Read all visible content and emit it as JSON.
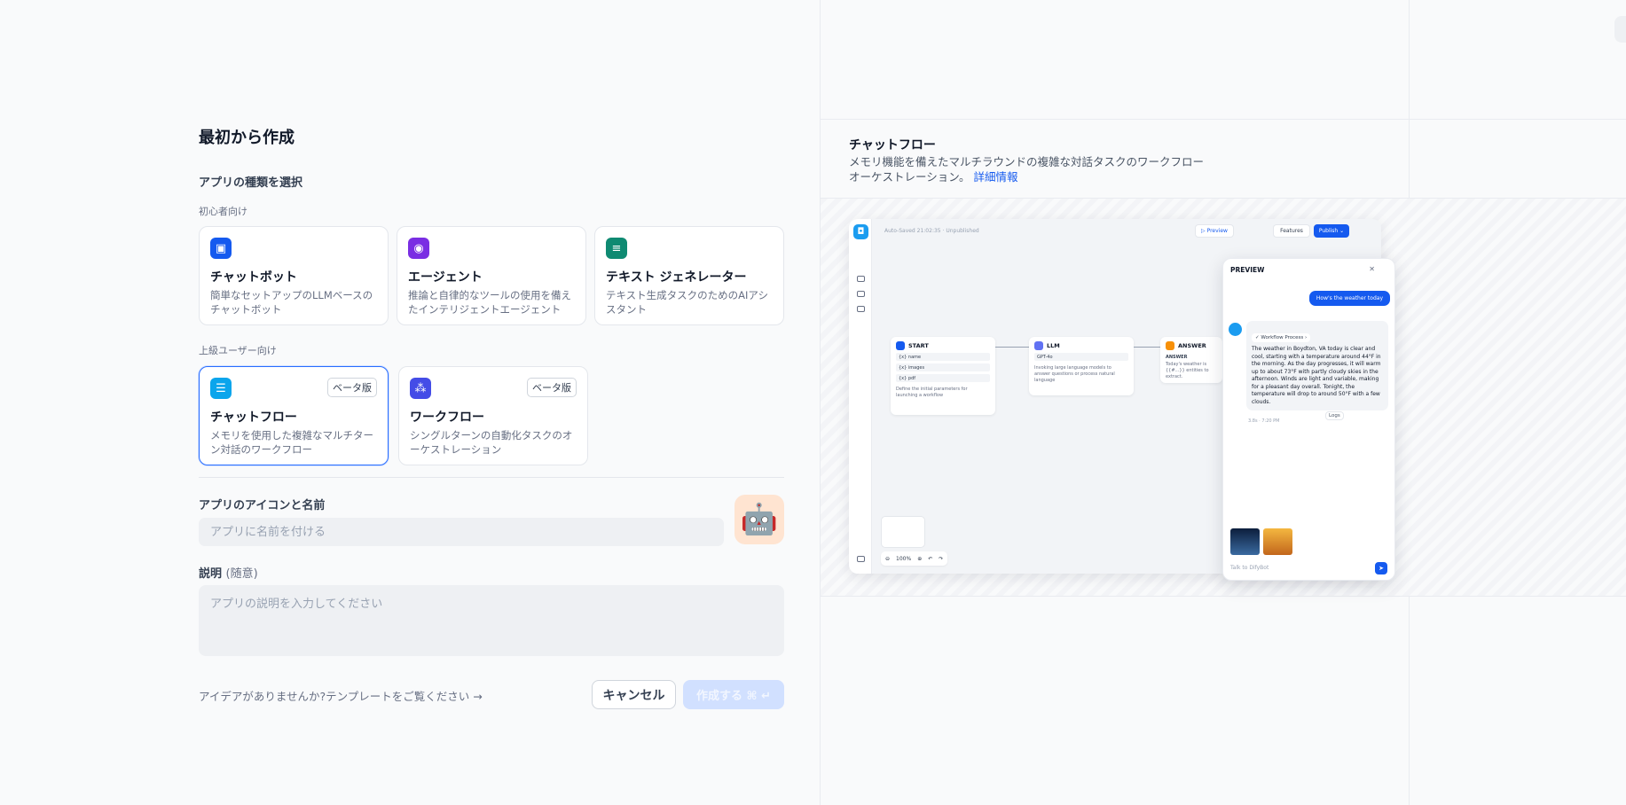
{
  "left": {
    "page_title": "最初から作成",
    "type_section_label": "アプリの種類を選択",
    "beginner_label": "初心者向け",
    "advanced_label": "上級ユーザー向け",
    "beginner_cards": [
      {
        "title": "チャットボット",
        "desc": "簡単なセットアップのLLMベースのチャットボット",
        "icon": "chatbot-icon",
        "color": "#155aef"
      },
      {
        "title": "エージェント",
        "desc": "推論と自律的なツールの使用を備えたインテリジェントエージェント",
        "icon": "agent-icon",
        "color": "#7a2ee3"
      },
      {
        "title": "テキスト ジェネレーター",
        "desc": "テキスト生成タスクのためのAIアシスタント",
        "icon": "text-generator-icon",
        "color": "#0f8a72"
      }
    ],
    "advanced_cards": [
      {
        "title": "チャットフロー",
        "desc": "メモリを使用した複雑なマルチターン対話のワークフロー",
        "icon": "chatflow-icon",
        "color": "#0ba5ec",
        "badge": "ベータ版",
        "selected": true
      },
      {
        "title": "ワークフロー",
        "desc": "シングルターンの自動化タスクのオーケストレーション",
        "icon": "workflow-icon",
        "color": "#444ce7",
        "badge": "ベータ版",
        "selected": false
      }
    ],
    "name_section_label": "アプリのアイコンと名前",
    "name_placeholder": "アプリに名前を付ける",
    "avatar_emoji": "🤖",
    "desc_section_label": "説明",
    "desc_optional": "(随意)",
    "desc_placeholder": "アプリの説明を入力してください",
    "template_link": "アイデアがありませんか?テンプレートをご覧ください →",
    "cancel_label": "キャンセル",
    "create_label": "作成する ⌘ ↵"
  },
  "right": {
    "title": "チャットフロー",
    "desc": "メモリ機能を備えたマルチラウンドの複雑な対話タスクのワークフローオーケストレーション。",
    "learn_more": "詳細情報",
    "mock": {
      "autosave": "Auto-Saved 21:02:35 · Unpublished",
      "preview_btn": "▷ Preview",
      "features_btn": "Features",
      "publish_btn": "Publish ⌄",
      "nodes": {
        "start": {
          "title": "START",
          "rows": [
            "{x} name",
            "{x} images",
            "{x} pdf"
          ],
          "desc": "Define the initial parameters for launching a workflow"
        },
        "llm": {
          "title": "LLM",
          "model": "GPT-4o",
          "desc": "Invoking large language models to answer questions or process natural language"
        },
        "answer": {
          "title": "ANSWER",
          "sub": "ANSWER",
          "desc": "Today's weather is {{#...}} entities to extract."
        }
      },
      "zoom": "100%",
      "chat": {
        "title": "PREVIEW",
        "user_msg": "How's the weather today",
        "workflow_pill": "✓ Workflow Process ›",
        "bot_msg": "The weather in Boydton, VA today is clear and cool, starting with a temperature around 44°F in the morning. As the day progresses, it will warm up to about 73°F with partly cloudy skies in the afternoon. Winds are light and variable, making for a pleasant day overall. Tonight, the temperature will drop to around 50°F with a few clouds.",
        "meta": "3.8s · 7:20 PM",
        "logs": "Logs",
        "input_placeholder": "Talk to DifyBot"
      }
    }
  }
}
